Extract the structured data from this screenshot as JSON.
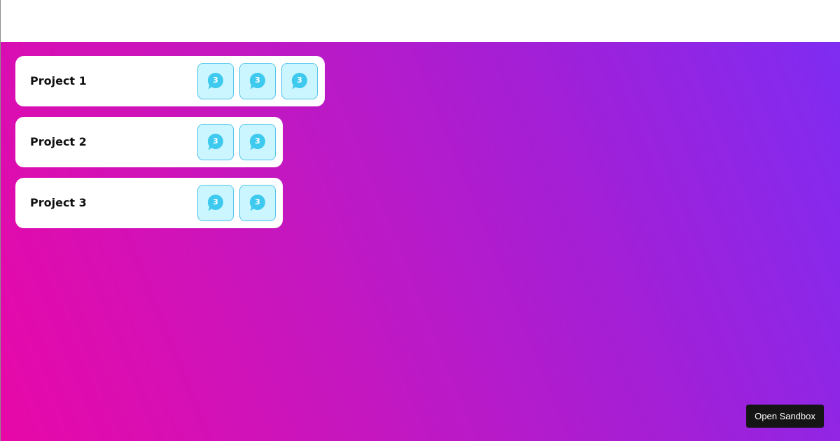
{
  "projects": [
    {
      "title": "Project 1",
      "badges": [
        {
          "icon": "chat-bubble-icon",
          "count": "3"
        },
        {
          "icon": "chat-bubble-icon",
          "count": "3"
        },
        {
          "icon": "chat-bubble-icon",
          "count": "3"
        }
      ]
    },
    {
      "title": "Project 2",
      "badges": [
        {
          "icon": "chat-bubble-icon",
          "count": "3"
        },
        {
          "icon": "chat-bubble-icon",
          "count": "3"
        }
      ]
    },
    {
      "title": "Project 3",
      "badges": [
        {
          "icon": "chat-bubble-icon",
          "count": "3"
        },
        {
          "icon": "chat-bubble-icon",
          "count": "3"
        }
      ]
    }
  ],
  "sandbox_button": {
    "label": "Open Sandbox"
  },
  "colors": {
    "gradient_start": "#e808a8",
    "gradient_end": "#7f2cf2",
    "badge_bg": "#ccf6ff",
    "badge_border": "#4fc3ea",
    "bubble": "#3ec9ef",
    "button_bg": "#151515"
  }
}
